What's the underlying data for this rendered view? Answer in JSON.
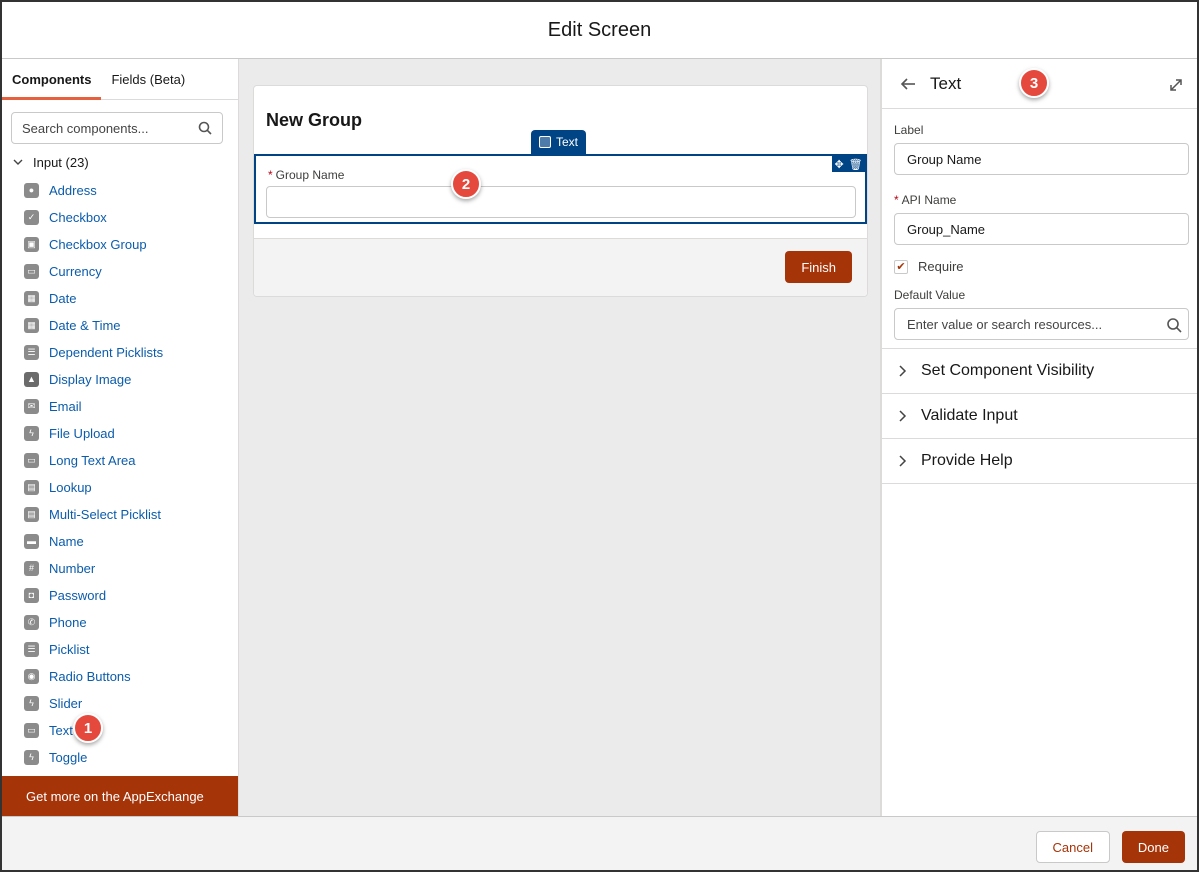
{
  "modal": {
    "title": "Edit Screen"
  },
  "left_panel": {
    "tabs": [
      {
        "label": "Components"
      },
      {
        "label": "Fields (Beta)"
      }
    ],
    "search_placeholder": "Search components...",
    "section_label": "Input (23)",
    "items": [
      {
        "label": "Address",
        "icon": "location-pin-icon"
      },
      {
        "label": "Checkbox",
        "icon": "checkbox-icon"
      },
      {
        "label": "Checkbox Group",
        "icon": "checkbox-group-icon"
      },
      {
        "label": "Currency",
        "icon": "currency-icon"
      },
      {
        "label": "Date",
        "icon": "calendar-icon"
      },
      {
        "label": "Date & Time",
        "icon": "datetime-icon"
      },
      {
        "label": "Dependent Picklists",
        "icon": "list-icon"
      },
      {
        "label": "Display Image",
        "icon": "image-icon"
      },
      {
        "label": "Email",
        "icon": "email-icon"
      },
      {
        "label": "File Upload",
        "icon": "bolt-icon"
      },
      {
        "label": "Long Text Area",
        "icon": "textarea-icon"
      },
      {
        "label": "Lookup",
        "icon": "lookup-icon"
      },
      {
        "label": "Multi-Select Picklist",
        "icon": "multi-picklist-icon"
      },
      {
        "label": "Name",
        "icon": "contact-card-icon"
      },
      {
        "label": "Number",
        "icon": "number-icon"
      },
      {
        "label": "Password",
        "icon": "lock-icon"
      },
      {
        "label": "Phone",
        "icon": "phone-icon"
      },
      {
        "label": "Picklist",
        "icon": "list-icon"
      },
      {
        "label": "Radio Buttons",
        "icon": "radio-icon"
      },
      {
        "label": "Slider",
        "icon": "bolt-icon"
      },
      {
        "label": "Text",
        "icon": "text-field-icon"
      },
      {
        "label": "Toggle",
        "icon": "bolt-icon"
      }
    ],
    "appexchange_label": "Get more on the AppExchange"
  },
  "canvas": {
    "card_title": "New Group",
    "selection_tab_label": "Text",
    "field_label": "Group Name",
    "finish_label": "Finish"
  },
  "right_panel": {
    "title": "Text",
    "label_caption": "Label",
    "label_value": "Group Name",
    "api_caption": "API Name",
    "api_value": "Group_Name",
    "require_label": "Require",
    "default_caption": "Default Value",
    "default_placeholder": "Enter value or search resources...",
    "sections": [
      {
        "label": "Set Component Visibility"
      },
      {
        "label": "Validate Input"
      },
      {
        "label": "Provide Help"
      }
    ]
  },
  "footer": {
    "cancel_label": "Cancel",
    "done_label": "Done"
  },
  "callouts": {
    "one": "1",
    "two": "2",
    "three": "3"
  },
  "colors": {
    "brand": "#a63409",
    "link": "#0b5cab",
    "selection": "#014486",
    "callout": "#e5483c"
  }
}
